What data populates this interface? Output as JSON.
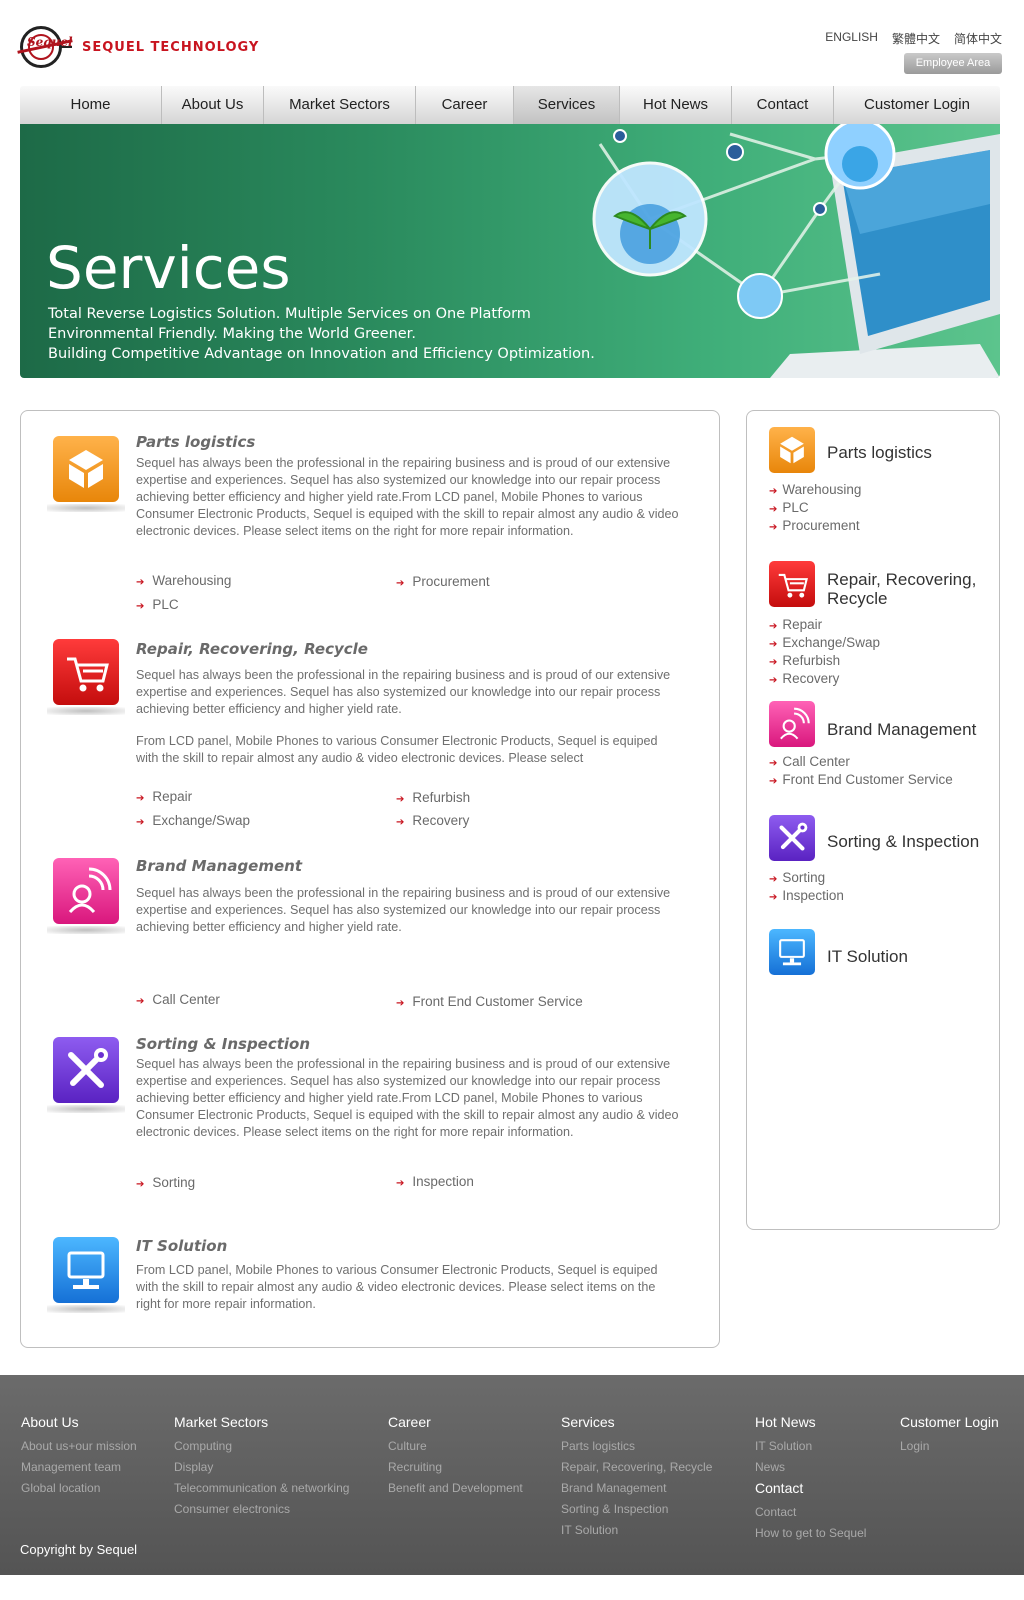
{
  "header": {
    "brand": "SEQUEL TECHNOLOGY",
    "logo_script": "Sequel",
    "languages": [
      "ENGLISH",
      "繁體中文",
      "简体中文"
    ],
    "employee_area": "Employee Area"
  },
  "nav": [
    {
      "label": "Home"
    },
    {
      "label": "About Us"
    },
    {
      "label": "Market Sectors"
    },
    {
      "label": "Career"
    },
    {
      "label": "Services",
      "active": true
    },
    {
      "label": "Hot News"
    },
    {
      "label": "Contact"
    },
    {
      "label": "Customer Login"
    }
  ],
  "banner": {
    "title": "Services",
    "lines": [
      "Total Reverse Logistics Solution. Multiple Services on One Platform",
      "Environmental Friendly. Making the World Greener.",
      "Building Competitive Advantage on Innovation and Efficiency Optimization."
    ]
  },
  "sections": [
    {
      "title": "Parts logistics",
      "text": "Sequel has always been the professional in the repairing business and is proud of our extensive expertise and experiences. Sequel has also systemized our knowledge into our repair process achieving better efficiency and higher yield rate.From LCD panel, Mobile Phones to various Consumer Electronic Products, Sequel is equiped with the skill to repair almost any audio & video electronic devices. Please select items on the right for more repair information.",
      "links": [
        "Warehousing",
        "Procurement",
        "PLC"
      ]
    },
    {
      "title": "Repair, Recovering, Recycle",
      "text": "Sequel has always been the professional in the repairing business and is proud of our extensive expertise and experiences. Sequel has also systemized our knowledge into our repair process achieving better efficiency and higher yield rate.",
      "text2": "From LCD panel, Mobile Phones to various Consumer Electronic Products, Sequel is equiped with the skill to repair almost any audio & video electronic devices. Please select",
      "links": [
        "Repair",
        "Refurbish",
        "Exchange/Swap",
        "Recovery"
      ]
    },
    {
      "title": "Brand Management",
      "text": "Sequel has always been the professional in the repairing business and is proud of our extensive expertise and experiences. Sequel has also systemized our knowledge into our repair process achieving better efficiency and higher yield rate.",
      "links": [
        "Call Center",
        "Front End Customer Service"
      ]
    },
    {
      "title": "Sorting & Inspection",
      "text": "Sequel has always been the professional in the repairing business and is proud of our extensive expertise and experiences. Sequel has also systemized our knowledge into our repair process achieving better efficiency and higher yield rate.From LCD panel, Mobile Phones to various Consumer Electronic Products, Sequel is equiped with the skill to repair almost any audio & video electronic devices. Please select items on the right for more repair information.",
      "links": [
        "Sorting",
        "Inspection"
      ]
    },
    {
      "title": "IT Solution",
      "text": "From LCD panel, Mobile Phones to various Consumer Electronic Products, Sequel is equiped with the skill to repair almost any audio & video electronic devices. Please select items on the right for more repair information.",
      "links": []
    }
  ],
  "sidebar": [
    {
      "title": "Parts logistics",
      "links": [
        "Warehousing",
        "PLC",
        "Procurement"
      ]
    },
    {
      "title": "Repair, Recovering, Recycle",
      "links": [
        "Repair",
        "Exchange/Swap",
        "Refurbish",
        "Recovery"
      ]
    },
    {
      "title": "Brand Management",
      "links": [
        "Call Center",
        "Front End Customer Service"
      ]
    },
    {
      "title": "Sorting & Inspection",
      "links": [
        "Sorting",
        "Inspection"
      ]
    },
    {
      "title": "IT Solution",
      "links": []
    }
  ],
  "footer": {
    "columns": [
      {
        "head": "About Us",
        "links": [
          "About us+our mission",
          "Management team",
          "Global location"
        ]
      },
      {
        "head": "Market Sectors",
        "links": [
          "Computing",
          "Display",
          "Telecommunication & networking",
          "Consumer electronics"
        ]
      },
      {
        "head": "Career",
        "links": [
          "Culture",
          "Recruiting",
          "Benefit and Development"
        ]
      },
      {
        "head": "Services",
        "links": [
          "Parts logistics",
          "Repair, Recovering, Recycle",
          "Brand Management",
          "Sorting & Inspection",
          "IT Solution"
        ]
      },
      {
        "head": "Hot News",
        "links": [
          "IT Solution",
          "News"
        ],
        "head2": "Contact",
        "links2": [
          "Contact",
          "How to get to Sequel"
        ]
      },
      {
        "head": "Customer Login",
        "links": [
          "Login"
        ]
      }
    ],
    "copyright": "Copyright by Sequel"
  },
  "colors": {
    "accent_red": "#c8141f",
    "banner_green": "#2a8a5d",
    "footer_gray": "#606060"
  },
  "icons": [
    "parts-box-icon",
    "cart-icon",
    "headset-icon",
    "tools-icon",
    "computer-icon",
    "arrow-right-icon"
  ]
}
